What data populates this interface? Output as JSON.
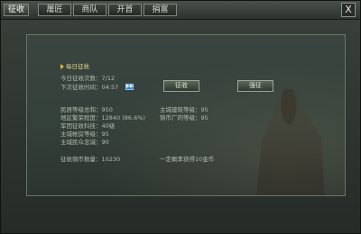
{
  "tabs": [
    {
      "label": "征收"
    },
    {
      "label": "屠匠"
    },
    {
      "label": "商队"
    },
    {
      "label": "开首"
    },
    {
      "label": "捐富"
    }
  ],
  "close_label": "X",
  "daily": {
    "header": "每日征收",
    "today_count": "今日征收次数：7/12",
    "next_time": "下次征收时间：04:57",
    "next_button": "▶▶",
    "levy_button": "征收",
    "force_button": "强征"
  },
  "stats": {
    "left": [
      "民居等级总和：950",
      "地区繁荣程度：12840 (86.6%)",
      "军团征收科技：40级",
      "主城帐房等级：95",
      "主城民众忠诚：90"
    ],
    "right": [
      "主城建筑等级：95",
      "铸币厂的等级：95"
    ]
  },
  "footer": {
    "coins": "征收铜币数量：10230",
    "chance": "一定概率获得10金币"
  },
  "colors": {
    "header_text": "#e9d38a",
    "arrow": "#e2b23a",
    "next_button": "#2d7fd0"
  },
  "icons": {
    "header_arrow": "triangle-right-icon",
    "next": "fast-forward-icon"
  }
}
